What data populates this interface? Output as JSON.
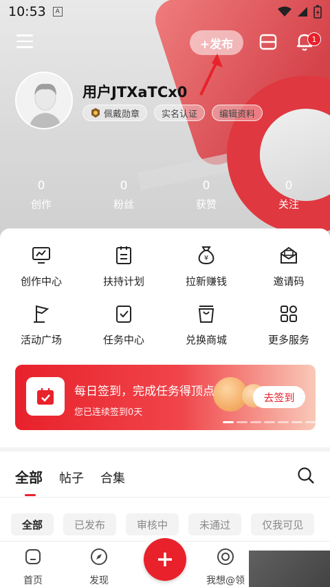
{
  "status_bar": {
    "time": "10:53",
    "indicator": "A"
  },
  "topbar": {
    "publish_label": "+发布",
    "notification_count": "1"
  },
  "profile": {
    "username": "用户JTXaTCx0",
    "tags": [
      "佩戴勋章",
      "实名认证",
      "编辑资料"
    ]
  },
  "stats": [
    {
      "value": "0",
      "label": "创作"
    },
    {
      "value": "0",
      "label": "粉丝"
    },
    {
      "value": "0",
      "label": "获赞"
    },
    {
      "value": "0",
      "label": "关注"
    }
  ],
  "services": [
    {
      "label": "创作中心",
      "icon": "monitor-icon"
    },
    {
      "label": "扶持计划",
      "icon": "clipboard-icon"
    },
    {
      "label": "拉新赚钱",
      "icon": "money-bag-icon"
    },
    {
      "label": "邀请码",
      "icon": "envelope-icon"
    },
    {
      "label": "活动广场",
      "icon": "flag-icon"
    },
    {
      "label": "任务中心",
      "icon": "task-check-icon"
    },
    {
      "label": "兑换商城",
      "icon": "shopping-bag-icon"
    },
    {
      "label": "更多服务",
      "icon": "grid-icon"
    }
  ],
  "checkin_banner": {
    "title": "每日签到，完成任务得顶点",
    "subtitle": "您已连续签到0天",
    "button_label": "去签到"
  },
  "content_tabs": [
    "全部",
    "帖子",
    "合集"
  ],
  "filters": [
    "全部",
    "已发布",
    "审核中",
    "未通过",
    "仅我可见"
  ],
  "bottom_nav": [
    {
      "label": "首页",
      "icon": "home-icon"
    },
    {
      "label": "发现",
      "icon": "compass-icon"
    },
    {
      "label": "我想@领",
      "icon": "target-icon"
    }
  ],
  "colors": {
    "accent": "#e8212b"
  }
}
